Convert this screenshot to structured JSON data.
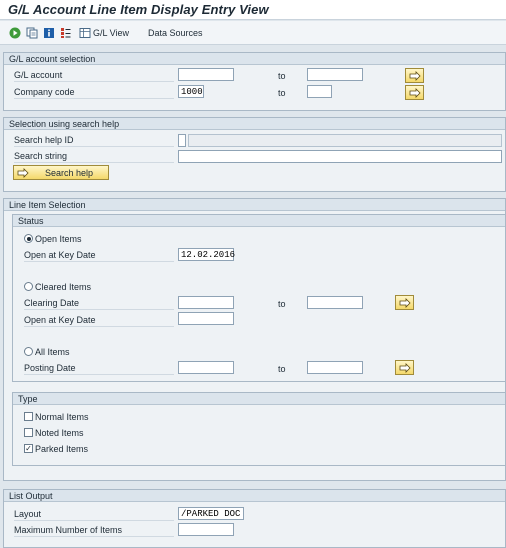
{
  "title": "G/L Account Line Item Display Entry View",
  "toolbar": {
    "gl_view_label": "G/L View",
    "data_sources_label": "Data Sources"
  },
  "gl_selection": {
    "header": "G/L account selection",
    "gl_account_label": "G/L account",
    "gl_account_from": "",
    "gl_account_to": "",
    "company_code_label": "Company code",
    "company_code_from": "1000",
    "company_code_to": "",
    "to_label": "to"
  },
  "search_help": {
    "header": "Selection using search help",
    "id_label": "Search help ID",
    "id_value": "",
    "string_label": "Search string",
    "string_value": "",
    "button_label": "Search help"
  },
  "line_item_selection": {
    "header": "Line Item Selection",
    "status": {
      "header": "Status",
      "open_items_label": "Open Items",
      "open_items_selected": true,
      "open_key_date_label": "Open at Key Date",
      "open_key_date_value": "12.02.2016",
      "cleared_items_label": "Cleared Items",
      "cleared_items_selected": false,
      "clearing_date_label": "Clearing Date",
      "clearing_date_from": "",
      "clearing_date_to": "",
      "cleared_open_key_date_label": "Open at Key Date",
      "cleared_open_key_date_value": "",
      "all_items_label": "All Items",
      "all_items_selected": false,
      "posting_date_label": "Posting Date",
      "posting_date_from": "",
      "posting_date_to": "",
      "to_label": "to"
    },
    "type": {
      "header": "Type",
      "normal_items_label": "Normal Items",
      "normal_items_checked": false,
      "noted_items_label": "Noted Items",
      "noted_items_checked": false,
      "parked_items_label": "Parked Items",
      "parked_items_checked": true,
      "check_mark": "✓"
    }
  },
  "list_output": {
    "header": "List Output",
    "layout_label": "Layout",
    "layout_value": "/PARKED DOC",
    "max_items_label": "Maximum Number of Items",
    "max_items_value": ""
  }
}
